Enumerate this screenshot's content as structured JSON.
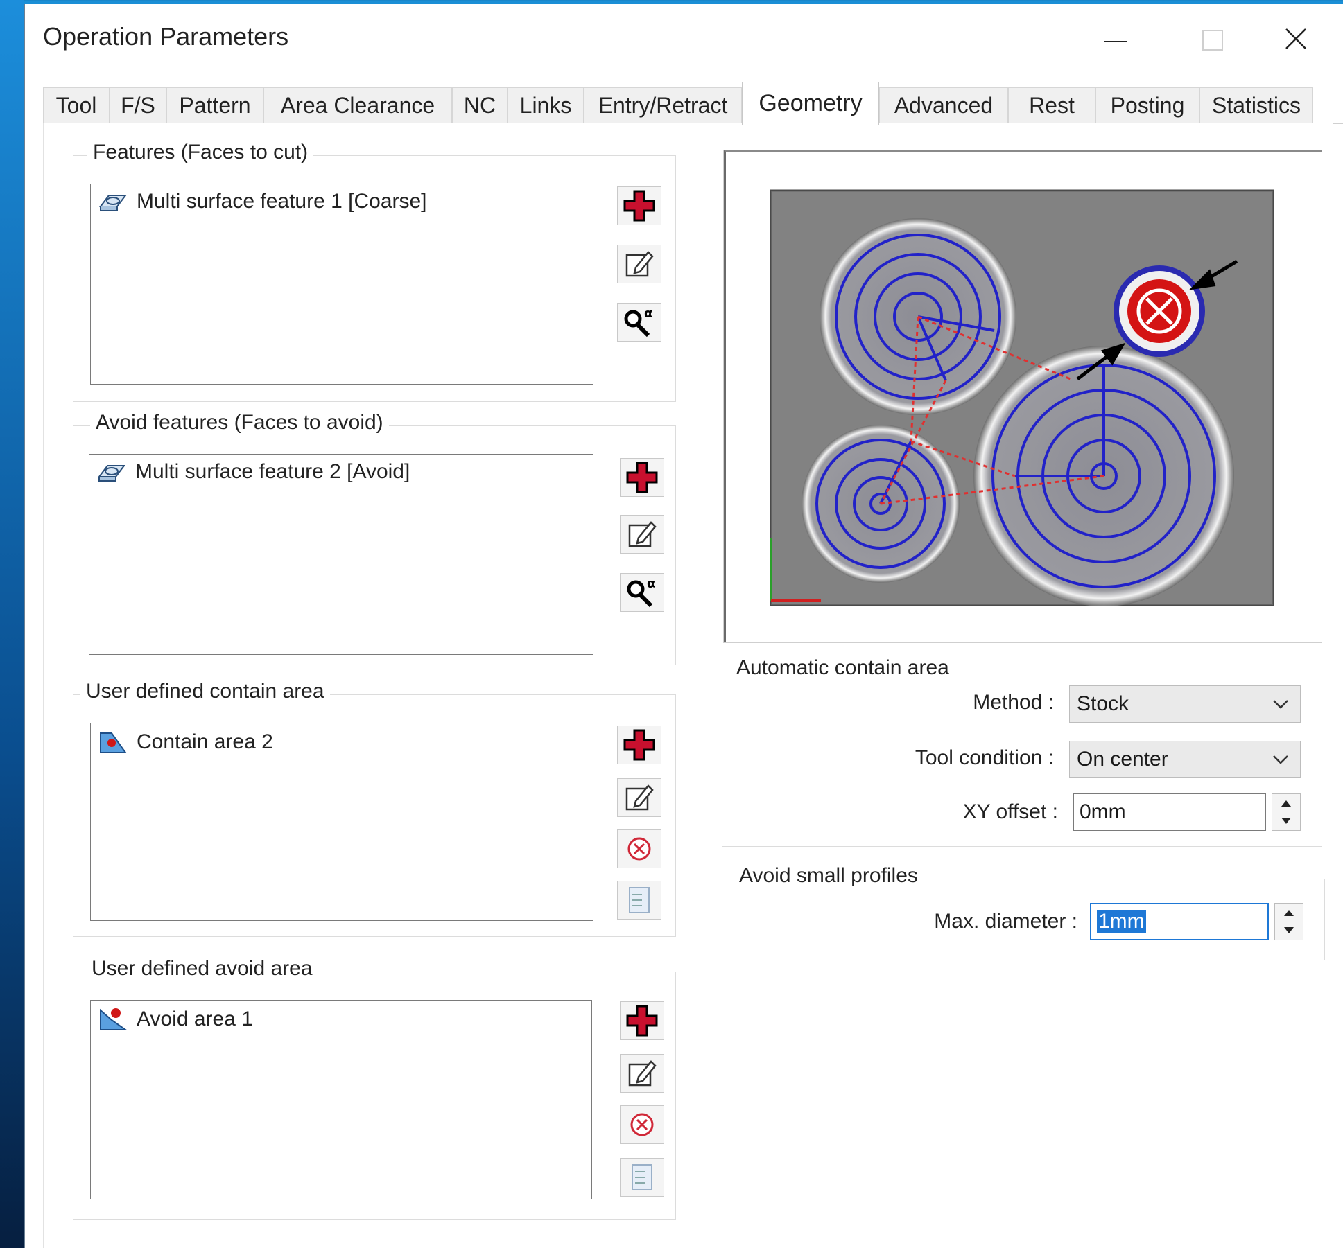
{
  "window": {
    "title": "Operation Parameters"
  },
  "tabs": [
    {
      "label": "Tool"
    },
    {
      "label": "F/S"
    },
    {
      "label": "Pattern"
    },
    {
      "label": "Area Clearance"
    },
    {
      "label": "NC"
    },
    {
      "label": "Links"
    },
    {
      "label": "Entry/Retract"
    },
    {
      "label": "Geometry",
      "active": true
    },
    {
      "label": "Advanced"
    },
    {
      "label": "Rest"
    },
    {
      "label": "Posting"
    },
    {
      "label": "Statistics"
    }
  ],
  "features": {
    "group_label": "Features (Faces to cut)",
    "items": [
      "Multi surface feature 1 [Coarse]"
    ]
  },
  "avoid_features": {
    "group_label": "Avoid features (Faces to avoid)",
    "items": [
      "Multi surface feature 2 [Avoid]"
    ]
  },
  "contain_area": {
    "group_label": "User defined contain area",
    "items": [
      "Contain area 2"
    ]
  },
  "avoid_area": {
    "group_label": "User defined avoid area",
    "items": [
      "Avoid area 1"
    ]
  },
  "auto_contain": {
    "group_label": "Automatic contain area",
    "method_label": "Method :",
    "method_value": "Stock",
    "tool_condition_label": "Tool condition :",
    "tool_condition_value": "On center",
    "xy_offset_label": "XY offset :",
    "xy_offset_value": "0mm"
  },
  "avoid_small": {
    "group_label": "Avoid small profiles",
    "max_diameter_label": "Max. diameter :",
    "max_diameter_value": "1mm"
  },
  "colors": {
    "accent": "#1e78d6",
    "add_red": "#c8102e",
    "toolpath_blue": "#2222c8",
    "stock_gray": "#808080"
  }
}
